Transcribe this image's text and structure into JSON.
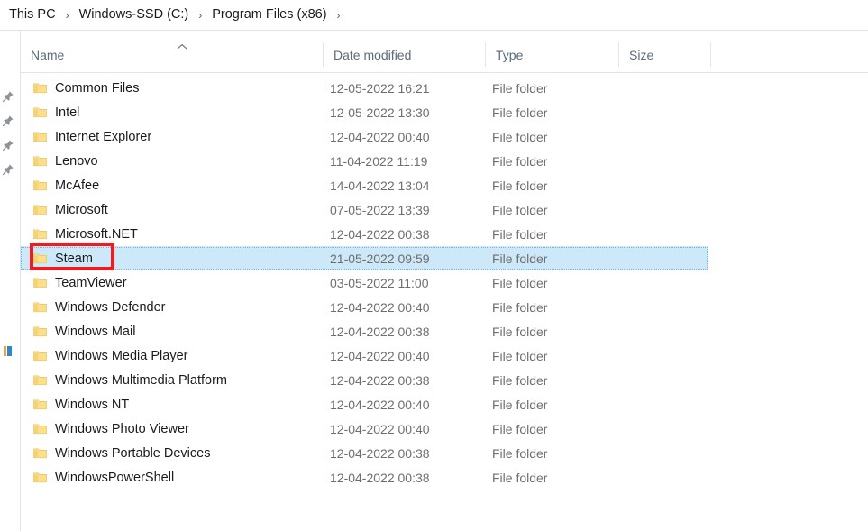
{
  "breadcrumb": {
    "items": [
      "This PC",
      "Windows-SSD (C:)",
      "Program Files (x86)"
    ],
    "separator": "›",
    "trailing_separator": "›"
  },
  "nav_pane": {
    "pin_icons": [
      "pin-icon",
      "pin-icon",
      "pin-icon",
      "pin-icon"
    ],
    "this_pc_icon": "this-pc-icon"
  },
  "columns": {
    "name": "Name",
    "date_modified": "Date modified",
    "type": "Type",
    "size": "Size",
    "sort_indicator": "sort-ascending-icon",
    "sorted_by": "Name"
  },
  "annotation": {
    "color": "#ee1c20",
    "target": "Steam"
  },
  "selection": {
    "selected_row": "Steam",
    "highlight_color": "#cce8f9"
  },
  "files": [
    {
      "name": "Common Files",
      "date": "12-05-2022 16:21",
      "type": "File folder",
      "size": "",
      "icon": "folder-icon"
    },
    {
      "name": "Intel",
      "date": "12-05-2022 13:30",
      "type": "File folder",
      "size": "",
      "icon": "folder-icon"
    },
    {
      "name": "Internet Explorer",
      "date": "12-04-2022 00:40",
      "type": "File folder",
      "size": "",
      "icon": "folder-icon"
    },
    {
      "name": "Lenovo",
      "date": "11-04-2022 11:19",
      "type": "File folder",
      "size": "",
      "icon": "folder-icon"
    },
    {
      "name": "McAfee",
      "date": "14-04-2022 13:04",
      "type": "File folder",
      "size": "",
      "icon": "folder-icon"
    },
    {
      "name": "Microsoft",
      "date": "07-05-2022 13:39",
      "type": "File folder",
      "size": "",
      "icon": "folder-icon"
    },
    {
      "name": "Microsoft.NET",
      "date": "12-04-2022 00:38",
      "type": "File folder",
      "size": "",
      "icon": "folder-icon"
    },
    {
      "name": "Steam",
      "date": "21-05-2022 09:59",
      "type": "File folder",
      "size": "",
      "icon": "folder-icon"
    },
    {
      "name": "TeamViewer",
      "date": "03-05-2022 11:00",
      "type": "File folder",
      "size": "",
      "icon": "folder-icon"
    },
    {
      "name": "Windows Defender",
      "date": "12-04-2022 00:40",
      "type": "File folder",
      "size": "",
      "icon": "folder-icon"
    },
    {
      "name": "Windows Mail",
      "date": "12-04-2022 00:38",
      "type": "File folder",
      "size": "",
      "icon": "folder-icon"
    },
    {
      "name": "Windows Media Player",
      "date": "12-04-2022 00:40",
      "type": "File folder",
      "size": "",
      "icon": "folder-icon"
    },
    {
      "name": "Windows Multimedia Platform",
      "date": "12-04-2022 00:38",
      "type": "File folder",
      "size": "",
      "icon": "folder-icon"
    },
    {
      "name": "Windows NT",
      "date": "12-04-2022 00:40",
      "type": "File folder",
      "size": "",
      "icon": "folder-icon"
    },
    {
      "name": "Windows Photo Viewer",
      "date": "12-04-2022 00:40",
      "type": "File folder",
      "size": "",
      "icon": "folder-icon"
    },
    {
      "name": "Windows Portable Devices",
      "date": "12-04-2022 00:38",
      "type": "File folder",
      "size": "",
      "icon": "folder-icon"
    },
    {
      "name": "WindowsPowerShell",
      "date": "12-04-2022 00:38",
      "type": "File folder",
      "size": "",
      "icon": "folder-icon"
    }
  ]
}
